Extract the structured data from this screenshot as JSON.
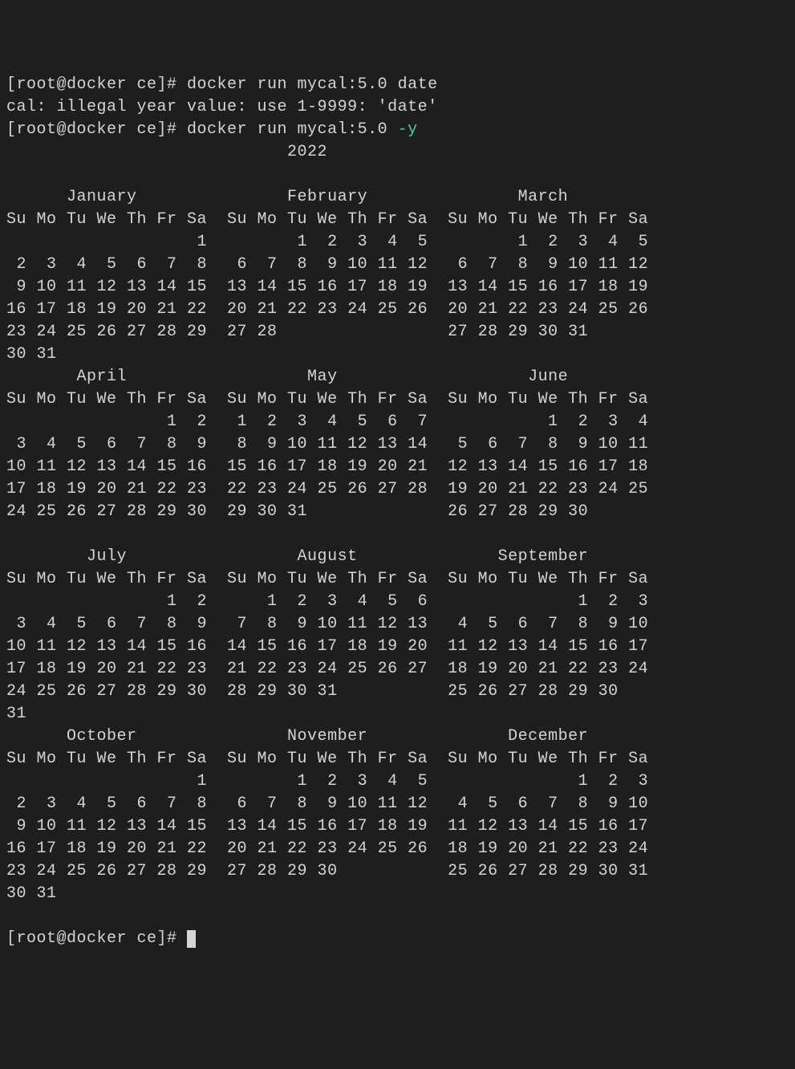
{
  "lines": [
    {
      "segments": [
        {
          "t": "[root@docker ce]# docker run mycal:5.0 date"
        }
      ]
    },
    {
      "segments": [
        {
          "t": "cal: illegal year value: use 1-9999: 'date'"
        }
      ]
    },
    {
      "segments": [
        {
          "t": "[root@docker ce]# docker run mycal:5.0 "
        },
        {
          "t": "-y",
          "cls": "flag"
        }
      ]
    },
    {
      "segments": [
        {
          "t": "                            2022"
        }
      ]
    },
    {
      "segments": [
        {
          "t": ""
        }
      ]
    },
    {
      "segments": [
        {
          "t": "      January               February               March          "
        }
      ]
    },
    {
      "segments": [
        {
          "t": "Su Mo Tu We Th Fr Sa  Su Mo Tu We Th Fr Sa  Su Mo Tu We Th Fr Sa  "
        }
      ]
    },
    {
      "segments": [
        {
          "t": "                   1         1  2  3  4  5         1  2  3  4  5  "
        }
      ]
    },
    {
      "segments": [
        {
          "t": " 2  3  4  5  6  7  8   6  7  8  9 10 11 12   6  7  8  9 10 11 12  "
        }
      ]
    },
    {
      "segments": [
        {
          "t": " 9 10 11 12 13 14 15  13 14 15 16 17 18 19  13 14 15 16 17 18 19  "
        }
      ]
    },
    {
      "segments": [
        {
          "t": "16 17 18 19 20 21 22  20 21 22 23 24 25 26  20 21 22 23 24 25 26  "
        }
      ]
    },
    {
      "segments": [
        {
          "t": "23 24 25 26 27 28 29  27 28                 27 28 29 30 31        "
        }
      ]
    },
    {
      "segments": [
        {
          "t": "30 31                                                             "
        }
      ]
    },
    {
      "segments": [
        {
          "t": "       April                  May                   June          "
        }
      ]
    },
    {
      "segments": [
        {
          "t": "Su Mo Tu We Th Fr Sa  Su Mo Tu We Th Fr Sa  Su Mo Tu We Th Fr Sa  "
        }
      ]
    },
    {
      "segments": [
        {
          "t": "                1  2   1  2  3  4  5  6  7            1  2  3  4  "
        }
      ]
    },
    {
      "segments": [
        {
          "t": " 3  4  5  6  7  8  9   8  9 10 11 12 13 14   5  6  7  8  9 10 11  "
        }
      ]
    },
    {
      "segments": [
        {
          "t": "10 11 12 13 14 15 16  15 16 17 18 19 20 21  12 13 14 15 16 17 18  "
        }
      ]
    },
    {
      "segments": [
        {
          "t": "17 18 19 20 21 22 23  22 23 24 25 26 27 28  19 20 21 22 23 24 25  "
        }
      ]
    },
    {
      "segments": [
        {
          "t": "24 25 26 27 28 29 30  29 30 31              26 27 28 29 30        "
        }
      ]
    },
    {
      "segments": [
        {
          "t": "                                                                  "
        }
      ]
    },
    {
      "segments": [
        {
          "t": "        July                 August              September        "
        }
      ]
    },
    {
      "segments": [
        {
          "t": "Su Mo Tu We Th Fr Sa  Su Mo Tu We Th Fr Sa  Su Mo Tu We Th Fr Sa  "
        }
      ]
    },
    {
      "segments": [
        {
          "t": "                1  2      1  2  3  4  5  6               1  2  3  "
        }
      ]
    },
    {
      "segments": [
        {
          "t": " 3  4  5  6  7  8  9   7  8  9 10 11 12 13   4  5  6  7  8  9 10  "
        }
      ]
    },
    {
      "segments": [
        {
          "t": "10 11 12 13 14 15 16  14 15 16 17 18 19 20  11 12 13 14 15 16 17  "
        }
      ]
    },
    {
      "segments": [
        {
          "t": "17 18 19 20 21 22 23  21 22 23 24 25 26 27  18 19 20 21 22 23 24  "
        }
      ]
    },
    {
      "segments": [
        {
          "t": "24 25 26 27 28 29 30  28 29 30 31           25 26 27 28 29 30     "
        }
      ]
    },
    {
      "segments": [
        {
          "t": "31                                                                "
        }
      ]
    },
    {
      "segments": [
        {
          "t": "      October               November              December        "
        }
      ]
    },
    {
      "segments": [
        {
          "t": "Su Mo Tu We Th Fr Sa  Su Mo Tu We Th Fr Sa  Su Mo Tu We Th Fr Sa  "
        }
      ]
    },
    {
      "segments": [
        {
          "t": "                   1         1  2  3  4  5               1  2  3  "
        }
      ]
    },
    {
      "segments": [
        {
          "t": " 2  3  4  5  6  7  8   6  7  8  9 10 11 12   4  5  6  7  8  9 10  "
        }
      ]
    },
    {
      "segments": [
        {
          "t": " 9 10 11 12 13 14 15  13 14 15 16 17 18 19  11 12 13 14 15 16 17  "
        }
      ]
    },
    {
      "segments": [
        {
          "t": "16 17 18 19 20 21 22  20 21 22 23 24 25 26  18 19 20 21 22 23 24  "
        }
      ]
    },
    {
      "segments": [
        {
          "t": "23 24 25 26 27 28 29  27 28 29 30           25 26 27 28 29 30 31  "
        }
      ]
    },
    {
      "segments": [
        {
          "t": "30 31                                                             "
        }
      ]
    },
    {
      "segments": [
        {
          "t": ""
        }
      ]
    },
    {
      "segments": [
        {
          "t": "[root@docker ce]# "
        }
      ],
      "cursor": true
    }
  ]
}
